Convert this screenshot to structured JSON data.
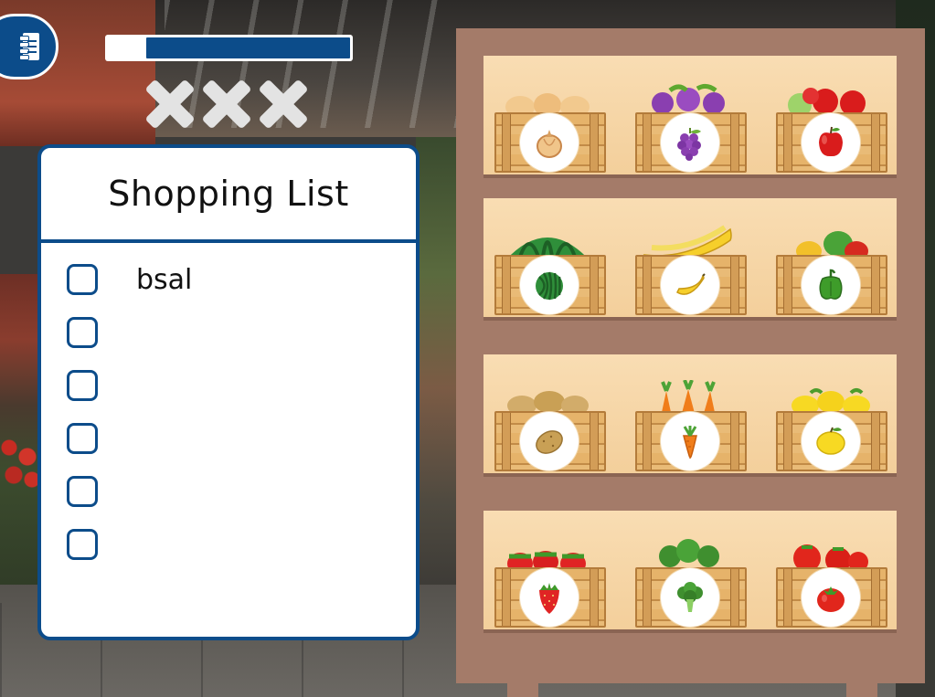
{
  "hud": {
    "progress_fraction": 0.84,
    "strikes": 3,
    "strike_icon": "x-mark-icon",
    "notebook_icon": "notebook-icon"
  },
  "shopping_list": {
    "title": "Shopping List",
    "items": [
      {
        "label": "bsal",
        "checked": false
      },
      {
        "label": "",
        "checked": false
      },
      {
        "label": "",
        "checked": false
      },
      {
        "label": "",
        "checked": false
      },
      {
        "label": "",
        "checked": false
      },
      {
        "label": "",
        "checked": false
      }
    ]
  },
  "shelf": {
    "tiers": [
      [
        "onion",
        "grapes",
        "apple"
      ],
      [
        "watermelon",
        "banana",
        "bell-pepper"
      ],
      [
        "potato",
        "carrot",
        "lemon"
      ],
      [
        "strawberry",
        "broccoli",
        "tomato"
      ]
    ]
  },
  "colors": {
    "accent": "#0c4c8a",
    "shelf": "#a47b69",
    "tier": "#f9ddb3",
    "crate": "#e6b36a"
  }
}
